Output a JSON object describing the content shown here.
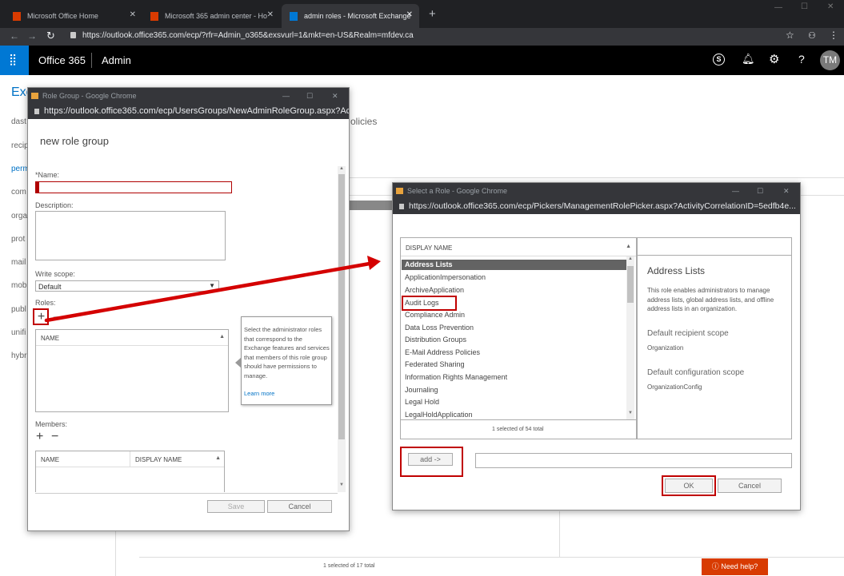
{
  "browser": {
    "tabs": [
      {
        "title": "Microsoft Office Home",
        "color": "#d83b01"
      },
      {
        "title": "Microsoft 365 admin center - Ho",
        "color": "#d83b01"
      },
      {
        "title": "admin roles - Microsoft Exchange",
        "color": "#0078d4"
      }
    ],
    "url": "https://outlook.office365.com/ecp/?rfr=Admin_o365&exsvurl=1&mkt=en-US&Realm=mfdev.ca"
  },
  "o365": {
    "brand": "Office 365",
    "section": "Admin",
    "avatar": "TM"
  },
  "background": {
    "title": "Exc",
    "nav": [
      "dast",
      "recip",
      "perm",
      "com",
      "orga",
      "prot",
      "mail",
      "mob",
      "publ",
      "unifi",
      "hybr"
    ],
    "policies_fragment": "olicies",
    "status": "1 selected of 17 total",
    "need_help": "Need help?"
  },
  "role_group_window": {
    "window_title": "Role Group - Google Chrome",
    "url": "https://outlook.office365.com/ecp/UsersGroups/NewAdminRoleGroup.aspx?Act...",
    "heading": "new role group",
    "name_label": "*Name:",
    "name_value": "",
    "description_label": "Description:",
    "write_scope_label": "Write scope:",
    "write_scope_value": "Default",
    "roles_label": "Roles:",
    "roles_column": "NAME",
    "tooltip": "Select the administrator roles that correspond to the Exchange features and services that members of this role group should have permissions to manage.",
    "learn_more": "Learn more",
    "members_label": "Members:",
    "members_columns": [
      "NAME",
      "DISPLAY NAME"
    ],
    "save": "Save",
    "cancel": "Cancel"
  },
  "select_role_window": {
    "window_title": "Select a Role - Google Chrome",
    "url": "https://outlook.office365.com/ecp/Pickers/ManagementRolePicker.aspx?ActivityCorrelationID=5edfb4e...",
    "column": "DISPLAY NAME",
    "roles": [
      "Address Lists",
      "ApplicationImpersonation",
      "ArchiveApplication",
      "Audit Logs",
      "Compliance Admin",
      "Data Loss Prevention",
      "Distribution Groups",
      "E-Mail Address Policies",
      "Federated Sharing",
      "Information Rights Management",
      "Journaling",
      "Legal Hold",
      "LegalHoldApplication"
    ],
    "status": "1 selected of 54 total",
    "detail_title": "Address Lists",
    "detail_desc": "This role enables administrators to manage address lists, global address lists, and offline address lists in an organization.",
    "recipient_scope_label": "Default recipient scope",
    "recipient_scope_value": "Organization",
    "config_scope_label": "Default configuration scope",
    "config_scope_value": "OrganizationConfig",
    "add": "add ->",
    "ok": "OK",
    "cancel": "Cancel"
  },
  "colors": {
    "highlight": "#c00000",
    "chrome_dark": "#202124",
    "link": "#0072c6"
  }
}
